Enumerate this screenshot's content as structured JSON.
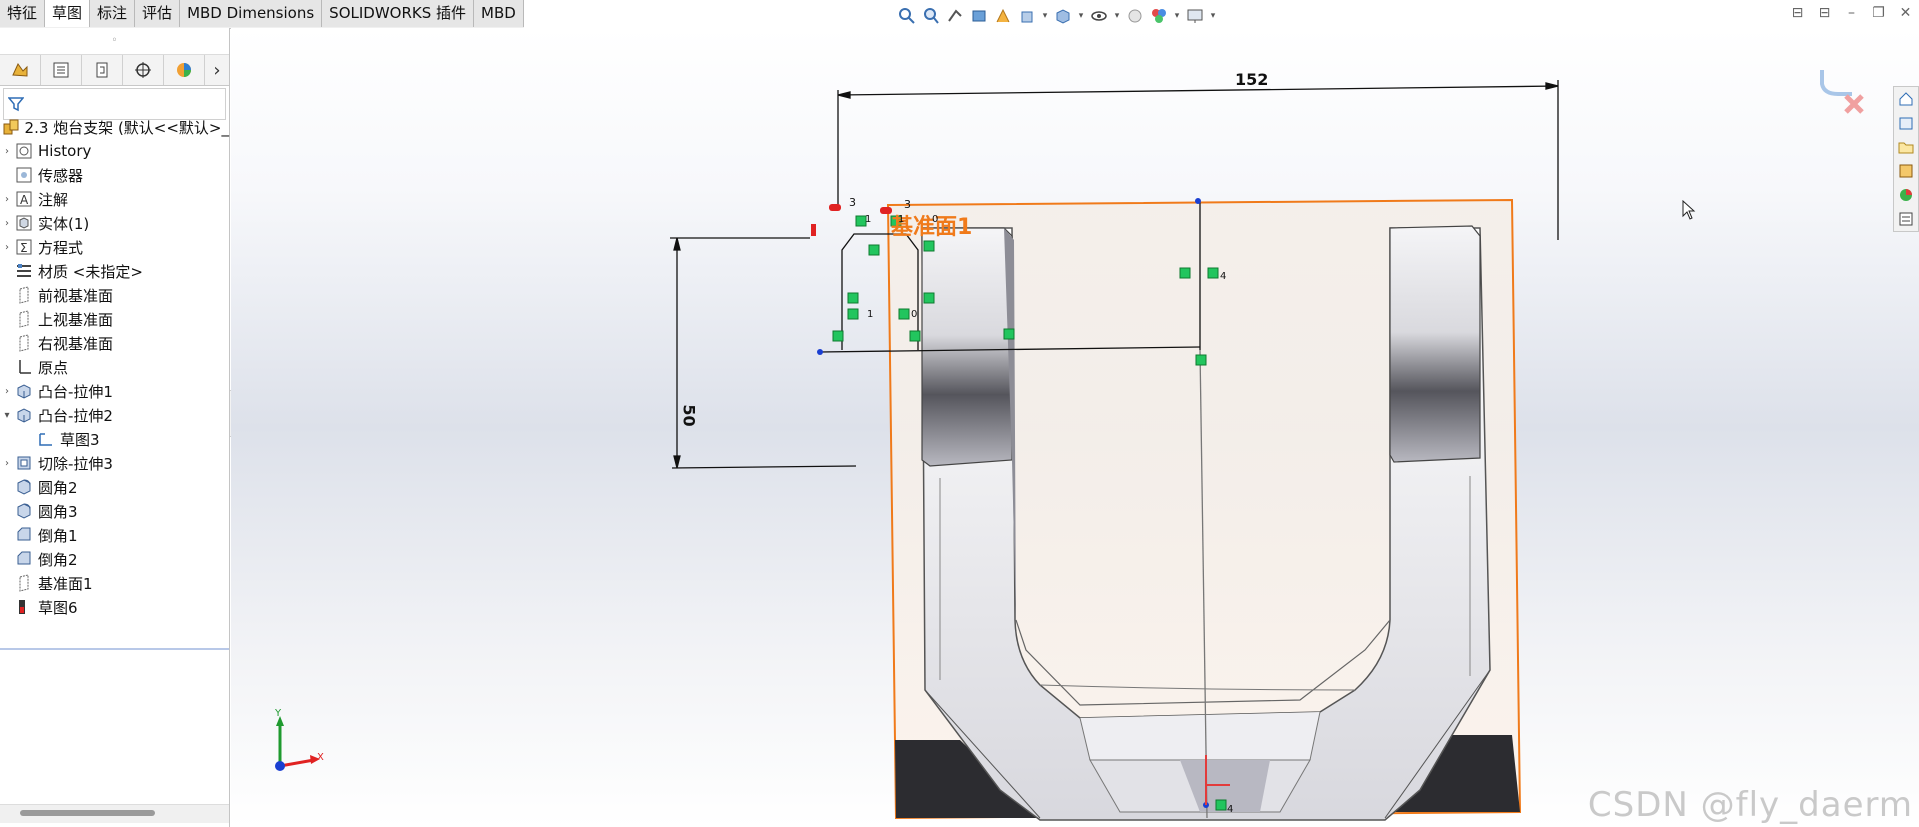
{
  "command_tabs": [
    "特征",
    "草图",
    "标注",
    "评估",
    "MBD Dimensions",
    "SOLIDWORKS 插件",
    "MBD"
  ],
  "active_tab_index": 1,
  "feature_tree": {
    "root": "2.3 炮台支架  (默认<<默认>_",
    "items": [
      {
        "label": "History",
        "icon": "history-icon",
        "expandable": true,
        "expanded": false,
        "indent": 0
      },
      {
        "label": "传感器",
        "icon": "sensor-icon",
        "expandable": false,
        "indent": 0
      },
      {
        "label": "注解",
        "icon": "annotation-icon",
        "expandable": true,
        "expanded": false,
        "indent": 0
      },
      {
        "label": "实体(1)",
        "icon": "solid-body-icon",
        "expandable": true,
        "expanded": false,
        "indent": 0
      },
      {
        "label": "方程式",
        "icon": "equation-icon",
        "expandable": true,
        "expanded": false,
        "indent": 0
      },
      {
        "label": "材质 <未指定>",
        "icon": "material-icon",
        "expandable": false,
        "indent": 0
      },
      {
        "label": "前视基准面",
        "icon": "plane-icon",
        "expandable": false,
        "indent": 0
      },
      {
        "label": "上视基准面",
        "icon": "plane-icon",
        "expandable": false,
        "indent": 0
      },
      {
        "label": "右视基准面",
        "icon": "plane-icon",
        "expandable": false,
        "indent": 0
      },
      {
        "label": "原点",
        "icon": "origin-icon",
        "expandable": false,
        "indent": 0
      },
      {
        "label": "凸台-拉伸1",
        "icon": "extrude-icon",
        "expandable": true,
        "expanded": false,
        "indent": 0
      },
      {
        "label": "凸台-拉伸2",
        "icon": "extrude-icon",
        "expandable": true,
        "expanded": true,
        "indent": 0
      },
      {
        "label": "草图3",
        "icon": "sketch-icon",
        "expandable": false,
        "indent": 1
      },
      {
        "label": "切除-拉伸3",
        "icon": "cut-extrude-icon",
        "expandable": true,
        "expanded": false,
        "indent": 0
      },
      {
        "label": "圆角2",
        "icon": "fillet-icon",
        "expandable": false,
        "indent": 0
      },
      {
        "label": "圆角3",
        "icon": "fillet-icon",
        "expandable": false,
        "indent": 0
      },
      {
        "label": "倒角1",
        "icon": "chamfer-icon",
        "expandable": false,
        "indent": 0
      },
      {
        "label": "倒角2",
        "icon": "chamfer-icon",
        "expandable": false,
        "indent": 0
      },
      {
        "label": "基准面1",
        "icon": "plane-icon",
        "expandable": false,
        "indent": 0
      },
      {
        "label": "草图6",
        "icon": "sketch-active-icon",
        "expandable": false,
        "indent": 0
      }
    ]
  },
  "viewport": {
    "plane_label": "基准面1",
    "dimensions": [
      "152",
      "50",
      "3",
      "3"
    ],
    "relation_labels": [
      "1",
      "1",
      "0",
      "1",
      "4",
      "0",
      "4"
    ],
    "axis_labels": {
      "x": "X",
      "y": "Y"
    }
  },
  "watermark": "CSDN @fly_daerm",
  "colors": {
    "plane": "#f07a1a",
    "relation": "#22c55e",
    "sketch": "#111111",
    "accent": "#1a5fd1"
  }
}
